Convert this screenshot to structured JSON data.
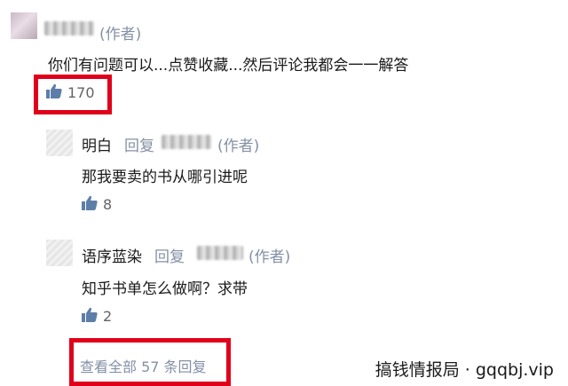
{
  "top_comment": {
    "author_tag": "(作者)",
    "text": "你们有问题可以...点赞收藏...然后评论我都会一一解答",
    "likes": "170"
  },
  "replies": [
    {
      "name": "明白",
      "reply_word": "回复",
      "author_tag": "(作者)",
      "text": "那我要卖的书从哪引进呢",
      "likes": "8"
    },
    {
      "name": "语序蓝染",
      "reply_word": "回复",
      "author_tag": "(作者)",
      "text": "知乎书单怎么做啊？求带",
      "likes": "2"
    }
  ],
  "view_all": "查看全部 57 条回复",
  "watermark": "搞钱情报局 · gqqbj.vip",
  "icons": {
    "like": "thumbs-up-icon"
  },
  "colors": {
    "highlight_box": "#e0001b",
    "meta_text": "#8590a6",
    "like_icon": "#5d7ea8"
  }
}
